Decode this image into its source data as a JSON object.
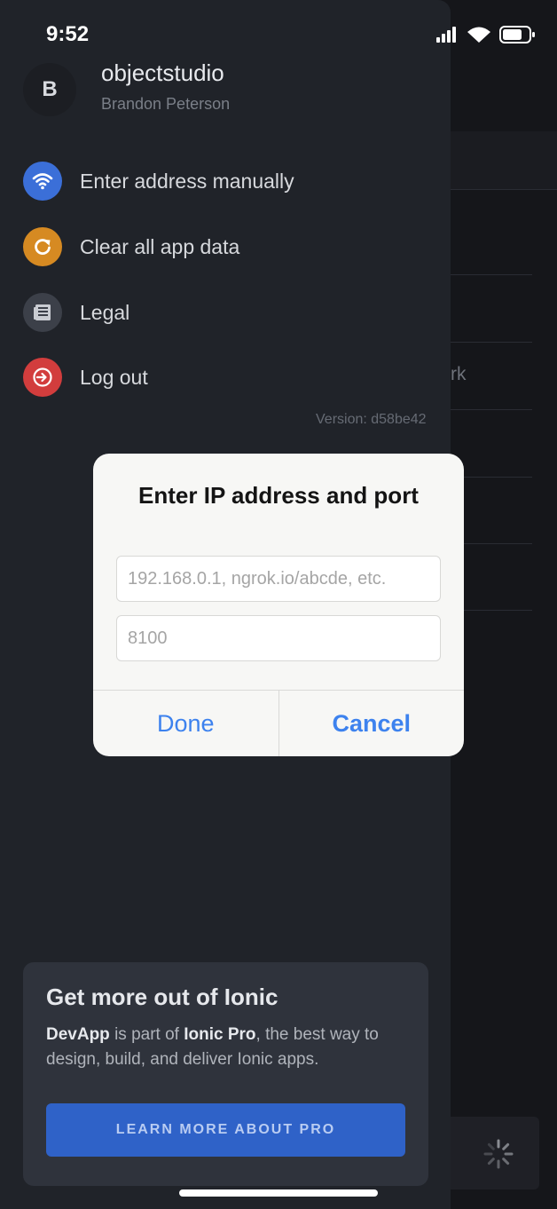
{
  "status_bar": {
    "time": "9:52"
  },
  "profile": {
    "initial": "B",
    "name": "objectstudio",
    "subtitle": "Brandon Peterson"
  },
  "menu": [
    {
      "label": "Enter address manually",
      "icon": "wifi-icon",
      "color": "#3b6fd8"
    },
    {
      "label": "Clear all app data",
      "icon": "refresh-icon",
      "color": "#d68a22"
    },
    {
      "label": "Legal",
      "icon": "document-icon",
      "color": "#3c4049"
    },
    {
      "label": "Log out",
      "icon": "logout-icon",
      "color": "#d23d3d"
    }
  ],
  "version": "Version: d58be42",
  "background": {
    "peek_text": "rk"
  },
  "promo": {
    "title": "Get more out of Ionic",
    "text_brand": "DevApp",
    "text_mid": " is part of ",
    "text_product": "Ionic Pro",
    "text_end": ", the best way to design, build, and deliver Ionic apps.",
    "button_label": "LEARN MORE ABOUT PRO"
  },
  "dialog": {
    "title": "Enter IP address and port",
    "address_placeholder": "192.168.0.1, ngrok.io/abcde, etc.",
    "port_placeholder": "8100",
    "done_label": "Done",
    "cancel_label": "Cancel"
  },
  "colors": {
    "accent": "#3d82ee",
    "promo_button": "#2f62c8"
  }
}
